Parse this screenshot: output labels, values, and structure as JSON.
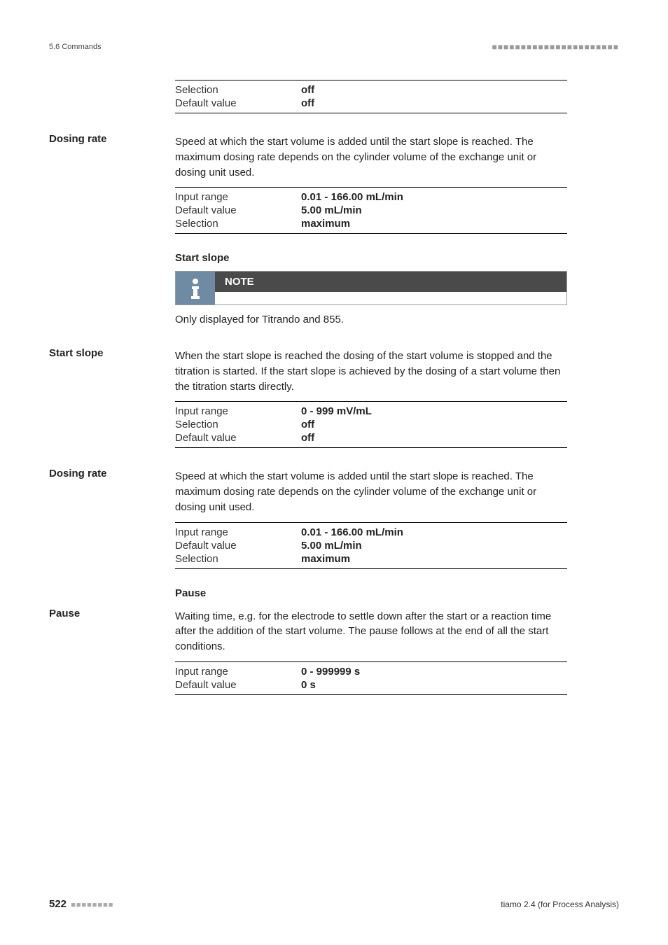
{
  "header": {
    "breadcrumb": "5.6 Commands",
    "dots": "■■■■■■■■■■■■■■■■■■■■■■"
  },
  "blocks": {
    "introTable": {
      "rows": [
        {
          "key": "Selection",
          "val": "off"
        },
        {
          "key": "Default value",
          "val": "off"
        }
      ]
    },
    "dosingRate1": {
      "label": "Dosing rate",
      "desc": "Speed at which the start volume is added until the start slope is reached. The maximum dosing rate depends on the cylinder volume of the exchange unit or dosing unit used.",
      "rows": [
        {
          "key": "Input range",
          "val": "0.01 - 166.00 mL/min"
        },
        {
          "key": "Default value",
          "val": "5.00 mL/min"
        },
        {
          "key": "Selection",
          "val": "maximum"
        }
      ]
    },
    "startSlopeHeading": "Start slope",
    "note": {
      "title": "NOTE",
      "text": "Only displayed for Titrando and 855."
    },
    "startSlope": {
      "label": "Start slope",
      "desc": "When the start slope is reached the dosing of the start volume is stopped and the titration is started. If the start slope is achieved by the dosing of a start volume then the titration starts directly.",
      "rows": [
        {
          "key": "Input range",
          "val": "0 - 999 mV/mL"
        },
        {
          "key": "Selection",
          "val": "off"
        },
        {
          "key": "Default value",
          "val": "off"
        }
      ]
    },
    "dosingRate2": {
      "label": "Dosing rate",
      "desc": "Speed at which the start volume is added until the start slope is reached. The maximum dosing rate depends on the cylinder volume of the exchange unit or dosing unit used.",
      "rows": [
        {
          "key": "Input range",
          "val": "0.01 - 166.00 mL/min"
        },
        {
          "key": "Default value",
          "val": "5.00 mL/min"
        },
        {
          "key": "Selection",
          "val": "maximum"
        }
      ]
    },
    "pauseHeading": "Pause",
    "pause": {
      "label": "Pause",
      "desc": "Waiting time, e.g. for the electrode to settle down after the start or a reaction time after the addition of the start volume. The pause follows at the end of all the start conditions.",
      "rows": [
        {
          "key": "Input range",
          "val": "0 - 999999 s"
        },
        {
          "key": "Default value",
          "val": "0 s"
        }
      ]
    }
  },
  "footer": {
    "page": "522",
    "dots": "■■■■■■■■",
    "text": "tiamo 2.4 (for Process Analysis)"
  }
}
